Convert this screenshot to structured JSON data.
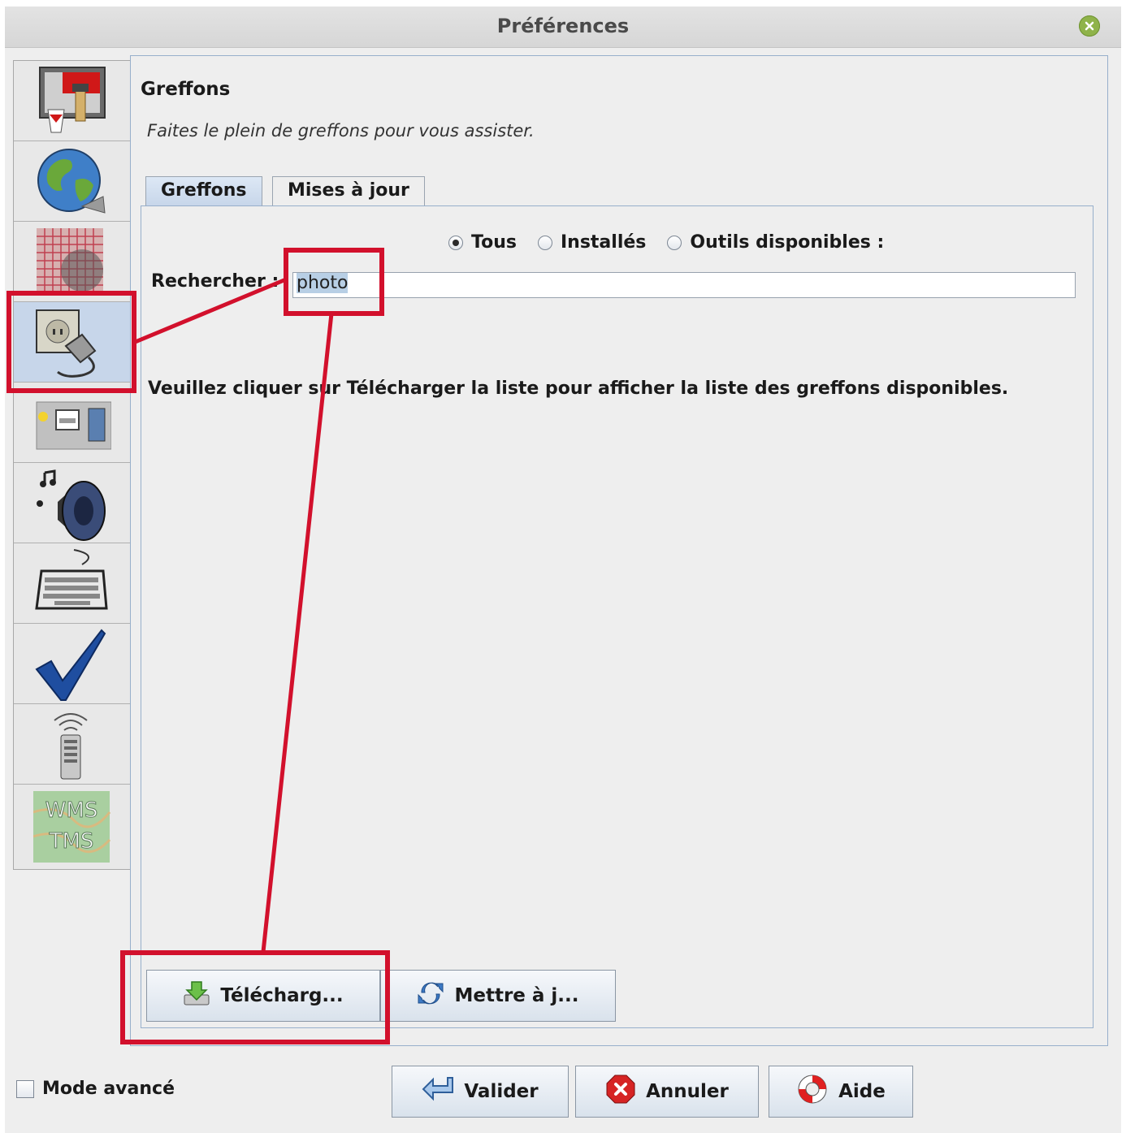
{
  "window": {
    "title": "Préférences"
  },
  "sidebar": {
    "items": [
      {
        "icon": "paint-brush-icon",
        "selected": false
      },
      {
        "icon": "globe-icon",
        "selected": false
      },
      {
        "icon": "projection-grid-icon",
        "selected": false
      },
      {
        "icon": "plugin-socket-icon",
        "selected": true
      },
      {
        "icon": "toolbar-icon",
        "selected": false
      },
      {
        "icon": "speaker-music-icon",
        "selected": false
      },
      {
        "icon": "keyboard-icon",
        "selected": false
      },
      {
        "icon": "checkmark-icon",
        "selected": false
      },
      {
        "icon": "remote-control-icon",
        "selected": false
      },
      {
        "icon": "wms-tms-icon",
        "selected": false,
        "text_line1": "WMS",
        "text_line2": "TMS"
      }
    ]
  },
  "main": {
    "title": "Greffons",
    "subtitle": "Faites le plein de greffons pour vous assister.",
    "tabs": [
      {
        "label": "Greffons",
        "active": true
      },
      {
        "label": "Mises à jour",
        "active": false
      }
    ],
    "filters": [
      {
        "label": "Tous",
        "checked": true
      },
      {
        "label": "Installés",
        "checked": false
      },
      {
        "label": "Outils disponibles :",
        "checked": false
      }
    ],
    "search": {
      "label": "Rechercher :",
      "value": "photo"
    },
    "message": "Veuillez cliquer sur Télécharger la liste pour afficher la liste des greffons disponibles.",
    "download_button": "Télécharg...",
    "update_button": "Mettre à j..."
  },
  "footer": {
    "advanced_mode": {
      "label": "Mode avancé",
      "checked": false
    },
    "validate_button": "Valider",
    "cancel_button": "Annuler",
    "help_button": "Aide"
  },
  "colors": {
    "annotation": "#d2102c",
    "selection": "#c7d6ea",
    "panel_border": "#97afcb"
  }
}
